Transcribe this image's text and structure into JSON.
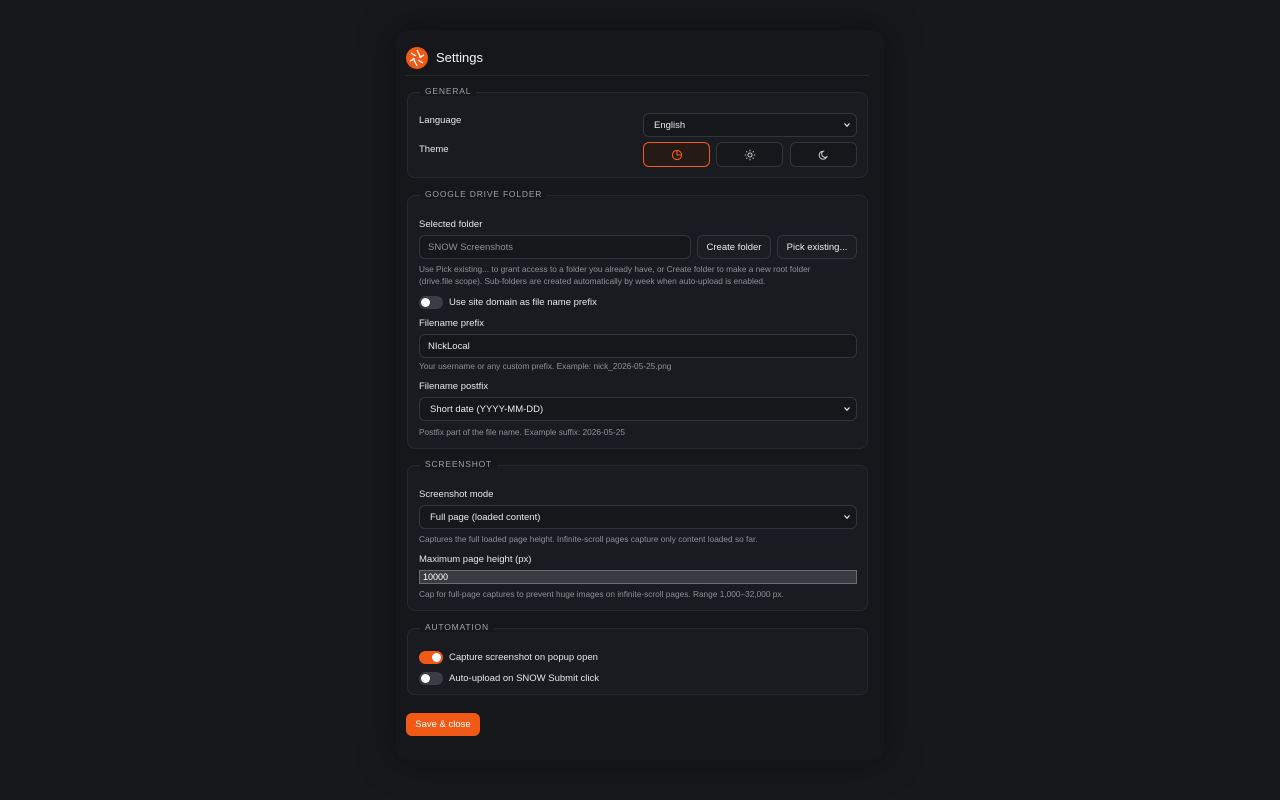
{
  "header": {
    "title": "Settings",
    "logo_icon": "aperture-logo-icon"
  },
  "colors": {
    "accent": "#f05a16",
    "background": "#17181c",
    "panel": "#16171b"
  },
  "general": {
    "legend": "GENERAL",
    "language_label": "Language",
    "language_value": "English",
    "theme_label": "Theme",
    "theme_options": [
      "system-icon",
      "sun-icon",
      "moon-icon"
    ],
    "theme_selected": "system"
  },
  "drive": {
    "legend": "GOOGLE DRIVE FOLDER",
    "selected_folder_label": "Selected folder",
    "selected_folder_placeholder": "SNOW Screenshots",
    "create_folder": "Create folder",
    "pick_existing": "Pick existing...",
    "help_line1": "Use Pick existing... to grant access to a folder you already have, or Create folder to make a new root folder",
    "help_line2": "(drive.file scope). Sub-folders are created automatically by week when auto-upload is enabled.",
    "site_domain_toggle": "Use site domain as file name prefix",
    "site_domain_on": false,
    "prefix_label": "Filename prefix",
    "prefix_value": "NIckLocal",
    "prefix_help": "Your username or any custom prefix. Example: nick_2026-05-25.png",
    "postfix_label": "Filename postfix",
    "postfix_value": "Short date (YYYY-MM-DD)",
    "postfix_help": "Postfix part of the file name. Example suffix: 2026-05-25"
  },
  "screenshot": {
    "legend": "SCREENSHOT",
    "mode_label": "Screenshot mode",
    "mode_value": "Full page (loaded content)",
    "mode_help": "Captures the full loaded page height. Infinite-scroll pages capture only content loaded so far.",
    "max_height_label": "Maximum page height (px)",
    "max_height_value": "10000",
    "max_height_help": "Cap for full-page captures to prevent huge images on infinite-scroll pages. Range 1,000–32,000 px."
  },
  "automation": {
    "legend": "AUTOMATION",
    "capture_on_open": "Capture screenshot on popup open",
    "capture_on_open_on": true,
    "auto_upload": "Auto-upload on SNOW Submit click",
    "auto_upload_on": false
  },
  "footer": {
    "save_label": "Save & close"
  }
}
